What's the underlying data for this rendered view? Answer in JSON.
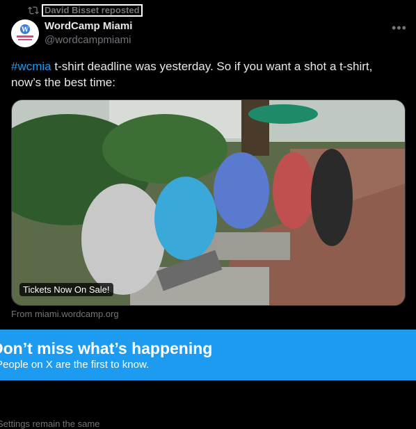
{
  "repost": {
    "label": "David Bisset reposted"
  },
  "author": {
    "name": "WordCamp Miami",
    "handle": "@wordcampmiami",
    "avatar_text": "WORDCAMP MIAMI"
  },
  "tweet": {
    "hashtag": "#wcmia",
    "body": " t-shirt deadline was yesterday. So if you want a shot a t-shirt, now’s the best time:"
  },
  "card": {
    "badge": "Tickets Now On Sale!",
    "source": "From miami.wordcamp.org"
  },
  "banner": {
    "title": "Don’t miss what’s happening",
    "subtitle": "People on X are the first to know."
  },
  "footer_text": "Settings remain the same",
  "colors": {
    "accent": "#1d9bf0",
    "muted": "#71767b",
    "text": "#e7e9ea"
  },
  "icons": {
    "repost": "repost-icon",
    "more": "more-icon"
  }
}
